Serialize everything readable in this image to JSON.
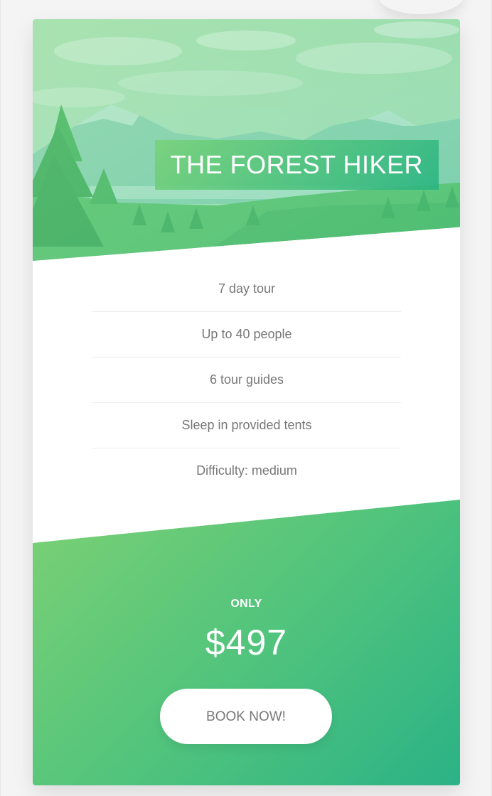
{
  "card": {
    "title": "THE FOREST HIKER",
    "features": [
      "7 day tour",
      "Up to 40 people",
      "6 tour guides",
      "Sleep in provided tents",
      "Difficulty: medium"
    ],
    "price_label": "ONLY",
    "price": "$497",
    "button_label": "BOOK NOW!"
  },
  "colors": {
    "gradient_light": "#7cd174",
    "gradient_dark": "#2bb286",
    "text_gray": "#777777"
  }
}
